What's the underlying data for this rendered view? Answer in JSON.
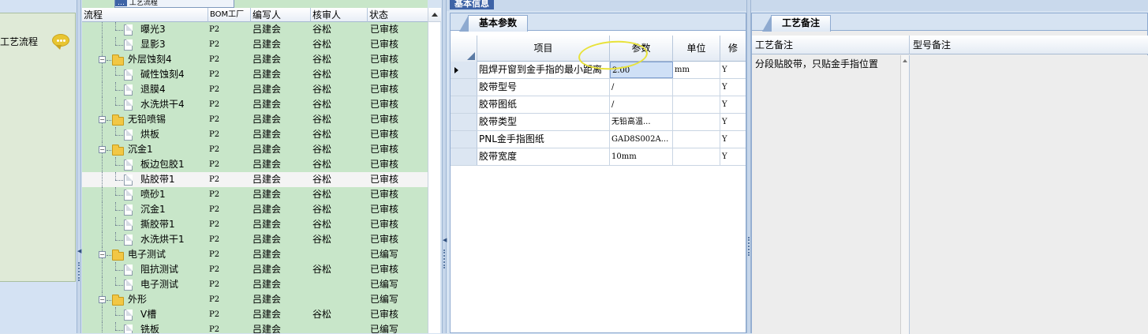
{
  "nav": {
    "item_label": "工艺流程"
  },
  "top_tab": {
    "label_left": "…",
    "label_right": "工艺流程"
  },
  "top_strip": {
    "tab_label": "基本信息"
  },
  "tree": {
    "columns": [
      "流程",
      "BOM工厂",
      "编写人",
      "核审人",
      "状态"
    ],
    "rows": [
      {
        "name": "曝光3",
        "kind": "doc",
        "factory": "P2",
        "writer": "吕建会",
        "reviewer": "谷松",
        "status": "已审核"
      },
      {
        "name": "显影3",
        "kind": "doc",
        "factory": "P2",
        "writer": "吕建会",
        "reviewer": "谷松",
        "status": "已审核"
      },
      {
        "name": "外层蚀刻4",
        "kind": "folder",
        "factory": "P2",
        "writer": "吕建会",
        "reviewer": "谷松",
        "status": "已审核"
      },
      {
        "name": "碱性蚀刻4",
        "kind": "doc",
        "factory": "P2",
        "writer": "吕建会",
        "reviewer": "谷松",
        "status": "已审核"
      },
      {
        "name": "退膜4",
        "kind": "doc",
        "factory": "P2",
        "writer": "吕建会",
        "reviewer": "谷松",
        "status": "已审核"
      },
      {
        "name": "水洗烘干4",
        "kind": "doc",
        "factory": "P2",
        "writer": "吕建会",
        "reviewer": "谷松",
        "status": "已审核"
      },
      {
        "name": "无铅喷锡",
        "kind": "folder",
        "factory": "P2",
        "writer": "吕建会",
        "reviewer": "谷松",
        "status": "已审核"
      },
      {
        "name": "烘板",
        "kind": "doc",
        "factory": "P2",
        "writer": "吕建会",
        "reviewer": "谷松",
        "status": "已审核"
      },
      {
        "name": "沉金1",
        "kind": "folder",
        "factory": "P2",
        "writer": "吕建会",
        "reviewer": "谷松",
        "status": "已审核"
      },
      {
        "name": "板边包胶1",
        "kind": "doc",
        "factory": "P2",
        "writer": "吕建会",
        "reviewer": "谷松",
        "status": "已审核"
      },
      {
        "name": "贴胶带1",
        "kind": "doc",
        "factory": "P2",
        "writer": "吕建会",
        "reviewer": "谷松",
        "status": "已审核",
        "selected": true
      },
      {
        "name": "喷砂1",
        "kind": "doc",
        "factory": "P2",
        "writer": "吕建会",
        "reviewer": "谷松",
        "status": "已审核"
      },
      {
        "name": "沉金1",
        "kind": "doc",
        "factory": "P2",
        "writer": "吕建会",
        "reviewer": "谷松",
        "status": "已审核"
      },
      {
        "name": "撕胶带1",
        "kind": "doc",
        "factory": "P2",
        "writer": "吕建会",
        "reviewer": "谷松",
        "status": "已审核"
      },
      {
        "name": "水洗烘干1",
        "kind": "doc",
        "factory": "P2",
        "writer": "吕建会",
        "reviewer": "谷松",
        "status": "已审核"
      },
      {
        "name": "电子测试",
        "kind": "folder",
        "factory": "P2",
        "writer": "吕建会",
        "reviewer": "",
        "status": "已编写"
      },
      {
        "name": "阻抗测试",
        "kind": "doc",
        "factory": "P2",
        "writer": "吕建会",
        "reviewer": "谷松",
        "status": "已审核"
      },
      {
        "name": "电子测试",
        "kind": "doc",
        "factory": "P2",
        "writer": "吕建会",
        "reviewer": "",
        "status": "已编写"
      },
      {
        "name": "外形",
        "kind": "folder",
        "factory": "P2",
        "writer": "吕建会",
        "reviewer": "",
        "status": "已编写"
      },
      {
        "name": "V槽",
        "kind": "doc",
        "factory": "P2",
        "writer": "吕建会",
        "reviewer": "谷松",
        "status": "已审核"
      },
      {
        "name": "铣板",
        "kind": "doc",
        "factory": "P2",
        "writer": "吕建会",
        "reviewer": "",
        "status": "已编写"
      }
    ]
  },
  "params": {
    "tab_label": "基本参数",
    "columns": [
      "项目",
      "参数",
      "单位",
      "修"
    ],
    "rows": [
      {
        "item": "阻焊开窗到金手指的最小距离",
        "value": "2.00",
        "unit": "mm",
        "flag": "Y",
        "current": true
      },
      {
        "item": "胶带型号",
        "value": "/",
        "unit": "",
        "flag": "Y"
      },
      {
        "item": "胶带图纸",
        "value": "/",
        "unit": "",
        "flag": "Y"
      },
      {
        "item": "胶带类型",
        "value": "无铅高温...",
        "unit": "",
        "flag": "Y"
      },
      {
        "item": "PNL金手指图纸",
        "value": "GAD8S002A...",
        "unit": "",
        "flag": "Y"
      },
      {
        "item": "胶带宽度",
        "value": "10mm",
        "unit": "",
        "flag": "Y"
      }
    ]
  },
  "notes": {
    "tab_label": "工艺备注",
    "columns": [
      "工艺备注",
      "型号备注"
    ],
    "process_note": "分段贴胶带，只贴金手指位置",
    "model_note": ""
  },
  "colors": {
    "tree_bg": "#c8e6c9",
    "accent": "#3e63a6",
    "panel_border": "#8eaad0"
  },
  "icons": {
    "nav": "speech-bubble-icon",
    "folder": "folder-icon",
    "doc": "document-icon"
  }
}
